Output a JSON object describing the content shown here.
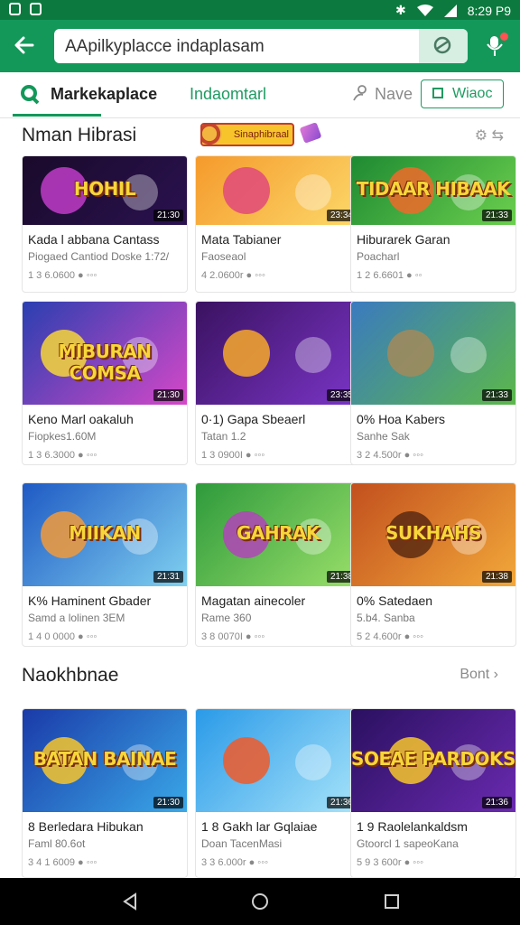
{
  "status_bar": {
    "time": "8:29 P9"
  },
  "search": {
    "value": "AApilkyplacce indaplasam"
  },
  "tabs": [
    {
      "label": "Markekaplace"
    },
    {
      "label": "Indaomtarl"
    },
    {
      "label": "Nave"
    },
    {
      "label": "Wiaoc"
    }
  ],
  "section1": {
    "title": "Nman Hibrasi",
    "promo_text": "Sinaphibraal",
    "actions": "⚙ ⇆"
  },
  "section2": {
    "title": "Naokhbnae",
    "link": "Bont ›"
  },
  "cards": [
    {
      "title": "HOHIL",
      "duration": "21:30",
      "name": "Kada l abbana Cantass",
      "sub": "Piogaed Cantiod Doske 1:72/",
      "stats": "1 3 6.0600 ● ◦◦◦",
      "theme": "dark-arcade"
    },
    {
      "title": "",
      "duration": "23:34",
      "name": "Mata Tabianer",
      "sub": "Faoseaol",
      "stats": "4 2.0600r ● ◦◦◦",
      "theme": "orange-bright"
    },
    {
      "title": "TIDAAR HIBAAK",
      "duration": "21:33",
      "name": "Hiburarek Garan",
      "sub": "Poacharl",
      "stats": "1 2 6.6601 ● ◦◦",
      "theme": "green-fox"
    },
    {
      "title": "MIBURAN COMSA",
      "duration": "21:30",
      "name": "Keno Marl oakaluh",
      "sub": "Fiopkes1.60M",
      "stats": "1 3 6.3000 ● ◦◦◦",
      "theme": "blue-candy"
    },
    {
      "title": "",
      "duration": "23:35",
      "name": "0·1) Gapa Sbeaerl",
      "sub": "Tatan 1.2",
      "stats": "1 3 0900I ● ◦◦◦",
      "theme": "purple-slot"
    },
    {
      "title": "",
      "duration": "21:33",
      "name": "0% Hoa Kabers",
      "sub": "Sanhe  Sak",
      "stats": "3 2 4.500r ● ◦◦◦",
      "theme": "green-castle"
    },
    {
      "title": "MIIKAN",
      "duration": "21:31",
      "name": "K% Haminent Gbader",
      "sub": "Samd a lolinen 3EM",
      "stats": "1 4 0 0000 ● ◦◦◦",
      "theme": "blue-cartoon"
    },
    {
      "title": "GAHRAK",
      "duration": "21:38",
      "name": "Magatan ainecoler",
      "sub": "Rame 360",
      "stats": "3 8 0070I ● ◦◦◦",
      "theme": "green-jungle"
    },
    {
      "title": "SUKHAHS",
      "duration": "21:38",
      "name": "0% Satedaen",
      "sub": "5.b4. Sanba",
      "stats": "5 2 4.600r ● ◦◦◦",
      "theme": "sunset"
    },
    {
      "title": "BATAN BAINAE",
      "duration": "21:30",
      "name": "8 Berledara Hibukan",
      "sub": "Faml 80.6ot",
      "stats": "3 4 1 6009 ● ◦◦◦",
      "theme": "blue-gems"
    },
    {
      "title": "",
      "duration": "21:36",
      "name": "1 8 Gakh lar Gqlaiae",
      "sub": "Doan TacenMasi",
      "stats": "3 3 6.000r ● ◦◦◦",
      "theme": "sky-hero"
    },
    {
      "title": "SOEAE PARDOKS",
      "duration": "21:36",
      "name": "1 9 Raolelankaldsm",
      "sub": "Gtoorcl 1 sapeoKana",
      "stats": "5 9 3 600r ● ◦◦◦",
      "theme": "purple-space"
    }
  ]
}
